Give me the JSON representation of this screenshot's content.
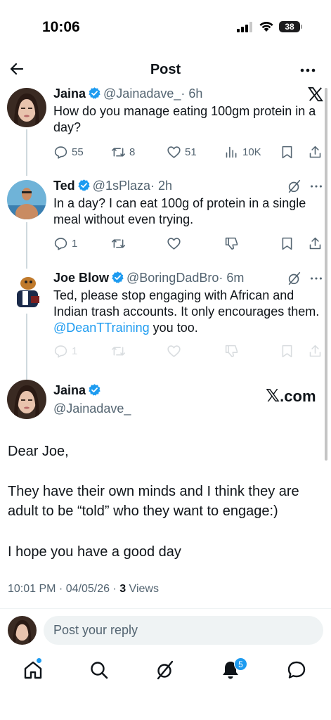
{
  "status_bar": {
    "time": "10:06",
    "battery": "38"
  },
  "header": {
    "title": "Post"
  },
  "tweets": [
    {
      "name": "Jaina",
      "handle": "@Jainadave_",
      "time": "· 6h",
      "text": "How do you manage eating 100gm protein in a day?",
      "replies": "55",
      "reposts": "8",
      "likes": "51",
      "views": "10K"
    },
    {
      "name": "Ted",
      "handle": "@1sPlaza",
      "time": "· 2h",
      "text": "In a day? I can eat 100g of protein in a single meal without even trying.",
      "replies": "1"
    },
    {
      "name": "Joe Blow",
      "handle": "@BoringDadBro",
      "time": "· 6m",
      "text_before": "Ted, please stop engaging with African and Indian trash accounts. It only encourages them. ",
      "mention": "@DeanTTraining",
      "text_after": " you too.",
      "replies": "1"
    }
  ],
  "main_post": {
    "name": "Jaina",
    "handle": "@Jainadave_",
    "xcom": ".com",
    "paragraphs": [
      "Dear Joe,",
      "They have their own minds and I think they are adult to be “told” who they want to engage:)",
      "I hope you have a good day"
    ],
    "timestamp": "10:01 PM · 04/05/26 · ",
    "views_count": "3",
    "views_label": " Views"
  },
  "reply": {
    "placeholder": "Post your reply"
  },
  "nav": {
    "notifications_badge": "5"
  },
  "colors": {
    "accent": "#1d9bf0",
    "text": "#0f1419",
    "muted": "#536471",
    "divider": "#cfd9de"
  },
  "icons": [
    "back-arrow-icon",
    "more-icon",
    "verified-icon",
    "x-logo-icon",
    "grok-icon",
    "reply-icon",
    "repost-icon",
    "like-icon",
    "views-icon",
    "bookmark-icon",
    "share-icon",
    "dislike-icon",
    "home-icon",
    "search-icon",
    "notifications-icon",
    "messages-icon"
  ]
}
